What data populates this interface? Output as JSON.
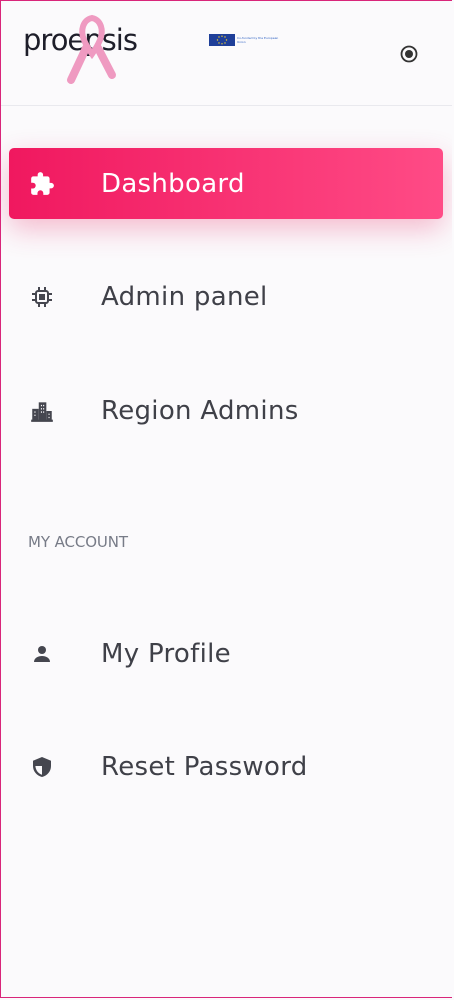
{
  "app": {
    "brand_text": "proepsis",
    "eu_text": "Co-funded by the European Union"
  },
  "icons": {
    "toggle": "radio-button-icon",
    "dashboard": "puzzle-icon",
    "admin_panel": "cpu-icon",
    "region_admins": "buildings-icon",
    "my_profile": "user-icon",
    "reset_password": "shield-icon"
  },
  "colors": {
    "accent_start": "#f0185f",
    "accent_end": "#ff4b86",
    "border": "#d9257a",
    "text": "#3f4048",
    "muted": "#777b87"
  },
  "menu": {
    "items": [
      {
        "label": "Dashboard"
      },
      {
        "label": "Admin panel"
      },
      {
        "label": "Region Admins"
      }
    ]
  },
  "account": {
    "section_title": "MY ACCOUNT",
    "items": [
      {
        "label": "My Profile"
      },
      {
        "label": "Reset Password"
      }
    ]
  }
}
